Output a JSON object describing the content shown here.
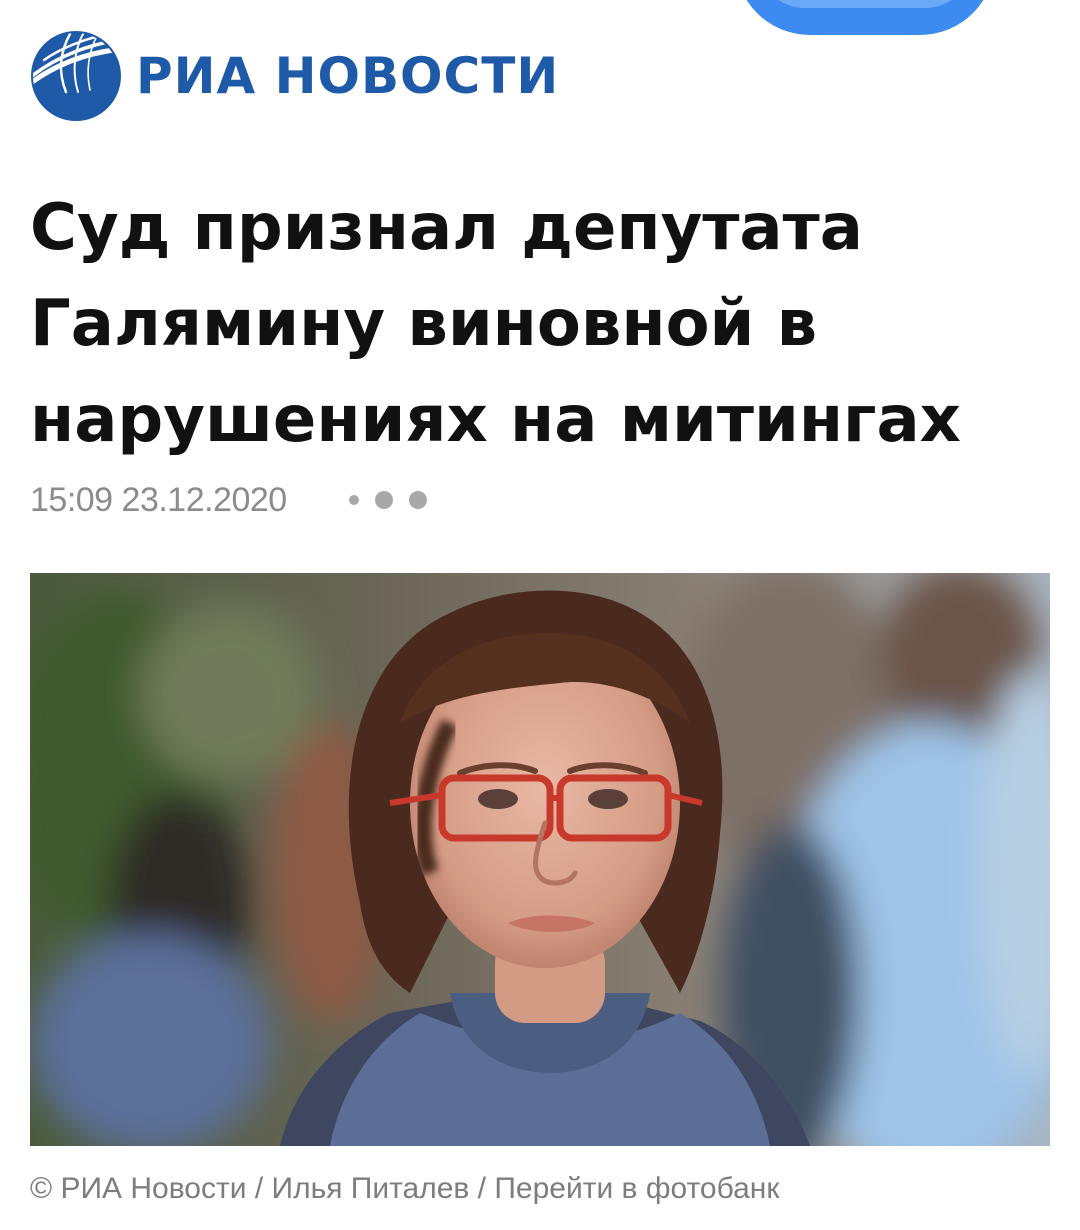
{
  "brand": {
    "name": "РИА НОВОСТИ",
    "logo_icon": "ria-globe-logo-icon",
    "color": "#1e5aa8"
  },
  "article": {
    "headline_lines": [
      "Суд признал депутата",
      "Галямину виновной в",
      "нарушениях на митингах"
    ],
    "timestamp": "15:09 23.12.2020",
    "more_icon": "more-dots-icon",
    "photo_subject": "woman-with-red-glasses-portrait"
  },
  "photo_credit": {
    "copyright": "© РИА Новости",
    "separator": " / ",
    "author": "Илья Питалев",
    "link_label": "Перейти в фотобанк"
  }
}
